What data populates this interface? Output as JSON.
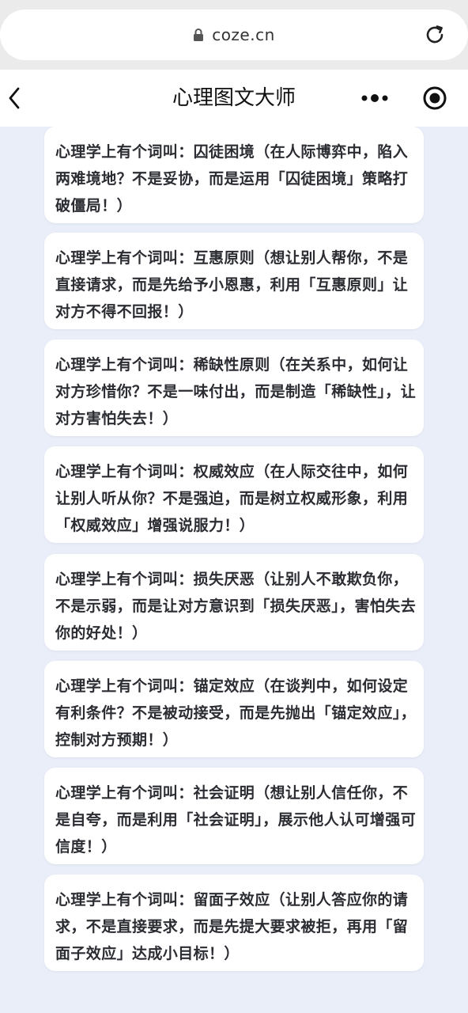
{
  "browser": {
    "url": "coze.cn",
    "icons": {
      "lock": "lock-icon",
      "reload": "reload-icon"
    }
  },
  "nav": {
    "title": "心理图文大师",
    "icons": {
      "back": "chevron-left-icon",
      "more": "more-dots-icon",
      "close": "target-circle-icon"
    }
  },
  "cards": [
    {
      "text": "心理学上有个词叫：囚徒困境（在人际博弈中，陷入两难境地？不是妥协，而是运用「囚徒困境」策略打破僵局！）"
    },
    {
      "text": "心理学上有个词叫：互惠原则（想让别人帮你，不是直接请求，而是先给予小恩惠，利用「互惠原则」让对方不得不回报！）"
    },
    {
      "text": "心理学上有个词叫：稀缺性原则（在关系中，如何让对方珍惜你？不是一味付出，而是制造「稀缺性」，让对方害怕失去！）"
    },
    {
      "text": "心理学上有个词叫：权威效应（在人际交往中，如何让别人听从你？不是强迫，而是树立权威形象，利用「权威效应」增强说服力！）"
    },
    {
      "text": "心理学上有个词叫：损失厌恶（让别人不敢欺负你，不是示弱，而是让对方意识到「损失厌恶」，害怕失去你的好处！）"
    },
    {
      "text": "心理学上有个词叫：锚定效应（在谈判中，如何设定有利条件？不是被动接受，而是先抛出「锚定效应」，控制对方预期！）"
    },
    {
      "text": "心理学上有个词叫：社会证明（想让别人信任你，不是自夸，而是利用「社会证明」，展示他人认可增强可信度！）"
    },
    {
      "text": "心理学上有个词叫：留面子效应（让别人答应你的请求，不是直接要求，而是先提大要求被拒，再用「留面子效应」达成小目标！）"
    }
  ]
}
